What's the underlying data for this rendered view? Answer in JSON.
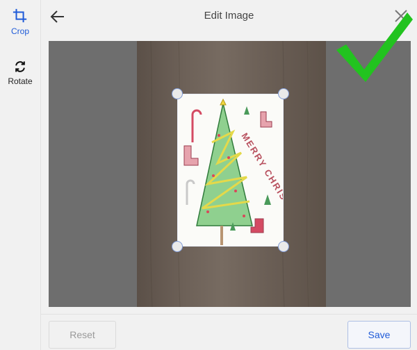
{
  "sidebar": {
    "crop_label": "Crop",
    "rotate_label": "Rotate"
  },
  "header": {
    "title": "Edit Image"
  },
  "drawing": {
    "greeting": "MERRY CHRISTMAS"
  },
  "footer": {
    "reset_label": "Reset",
    "save_label": "Save"
  },
  "colors": {
    "accent": "#1f5bd8",
    "checkmark": "#22c31f"
  }
}
